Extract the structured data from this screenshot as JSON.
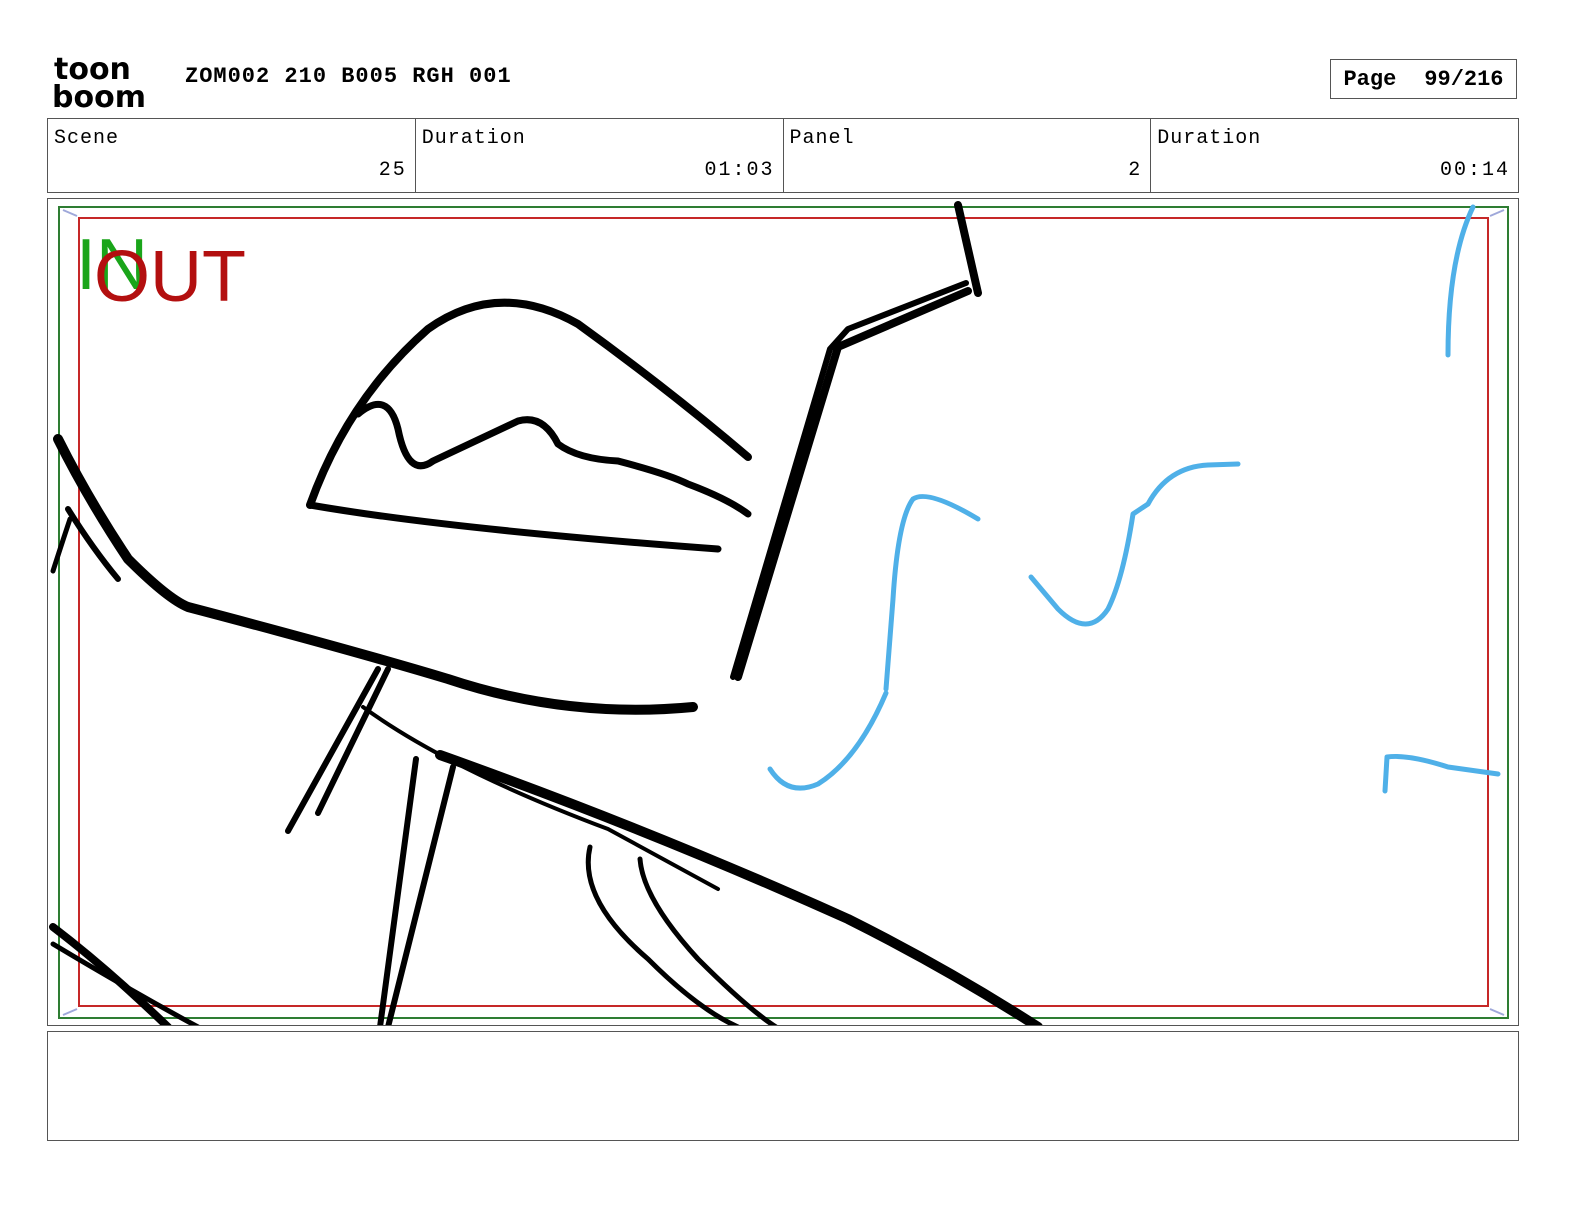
{
  "header": {
    "logo_text_top": "toon",
    "logo_text_bottom": "boom",
    "title": "ZOM002 210 B005 RGH 001",
    "page_label": "Page",
    "page_value": "99/216"
  },
  "info": {
    "scene_label": "Scene",
    "scene_value": "25",
    "scene_duration_label": "Duration",
    "scene_duration_value": "01:03",
    "panel_label": "Panel",
    "panel_value": "2",
    "panel_duration_label": "Duration",
    "panel_duration_value": "00:14"
  },
  "panel": {
    "in_marker": "IN",
    "out_marker": "OUT",
    "safe_frame_color": "#2e7d32",
    "action_frame_color": "#c62828",
    "sketch_color": "#000000",
    "accent_sketch_color": "#4fb0e8"
  },
  "notes": {
    "text": ""
  }
}
